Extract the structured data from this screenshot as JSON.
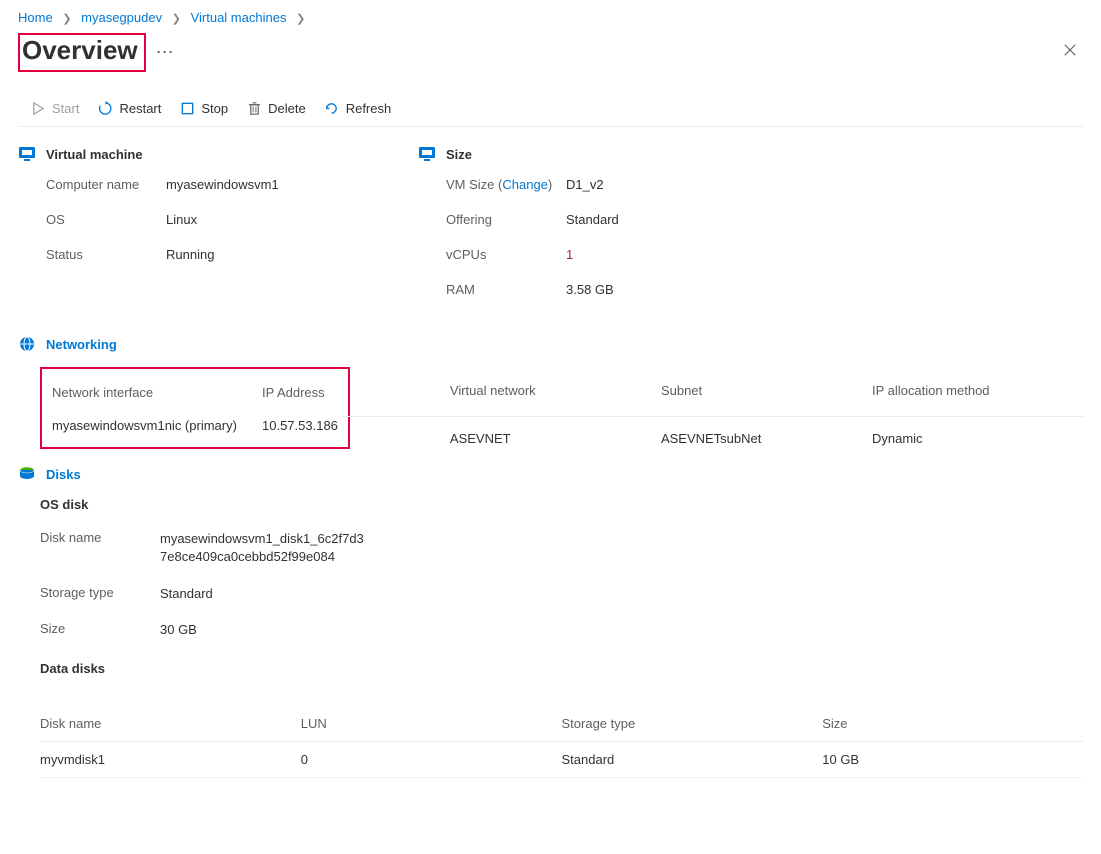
{
  "breadcrumb": {
    "items": [
      {
        "label": "Home"
      },
      {
        "label": "myasegpudev"
      },
      {
        "label": "Virtual machines"
      }
    ]
  },
  "title": "Overview",
  "toolbar": {
    "start": "Start",
    "restart": "Restart",
    "stop": "Stop",
    "delete": "Delete",
    "refresh": "Refresh"
  },
  "vm": {
    "section_title": "Virtual machine",
    "computer_name_label": "Computer name",
    "computer_name": "myasewindowsvm1",
    "os_label": "OS",
    "os": "Linux",
    "status_label": "Status",
    "status": "Running"
  },
  "size": {
    "section_title": "Size",
    "vmsize_label": "VM Size",
    "change_label": "Change",
    "vmsize": "D1_v2",
    "offering_label": "Offering",
    "offering": "Standard",
    "vcpus_label": "vCPUs",
    "vcpus": "1",
    "ram_label": "RAM",
    "ram": "3.58 GB"
  },
  "networking": {
    "section_title": "Networking",
    "headers": {
      "nic": "Network interface",
      "ip": "IP Address",
      "vnet": "Virtual network",
      "subnet": "Subnet",
      "alloc": "IP allocation method"
    },
    "row": {
      "nic": "myasewindowsvm1nic (primary)",
      "ip": "10.57.53.186",
      "vnet": "ASEVNET",
      "subnet": "ASEVNETsubNet",
      "alloc": "Dynamic"
    }
  },
  "disks": {
    "section_title": "Disks",
    "os_disk_heading": "OS disk",
    "disk_name_label": "Disk name",
    "disk_name": "myasewindowsvm1_disk1_6c2f7d37e8ce409ca0cebbd52f99e084",
    "storage_type_label": "Storage type",
    "storage_type": "Standard",
    "size_label": "Size",
    "size": "30 GB",
    "data_disks_heading": "Data disks",
    "table_headers": {
      "name": "Disk name",
      "lun": "LUN",
      "storage": "Storage type",
      "size": "Size"
    },
    "data_disks": [
      {
        "name": "myvmdisk1",
        "lun": "0",
        "storage": "Standard",
        "size": "10 GB"
      }
    ]
  }
}
